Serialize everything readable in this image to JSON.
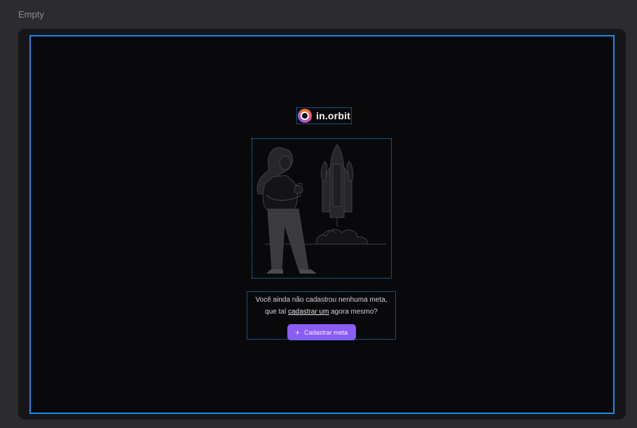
{
  "frame": {
    "label": "Empty"
  },
  "brand": {
    "name": "in.orbit"
  },
  "illustration": {
    "alt": "launch-illustration"
  },
  "empty_state": {
    "message_line1": "Você ainda não cadastrou nenhuma meta,",
    "message_prefix": "que tal ",
    "message_link": "cadastrar um",
    "message_suffix": " agora mesmo?",
    "button_icon": "+",
    "button_label": "Cadastrar meta"
  },
  "colors": {
    "page_bg": "#2c2c2e",
    "canvas_bg": "#09090b",
    "selection_outline": "#1e88e5",
    "accent": "#8b5cf6"
  }
}
